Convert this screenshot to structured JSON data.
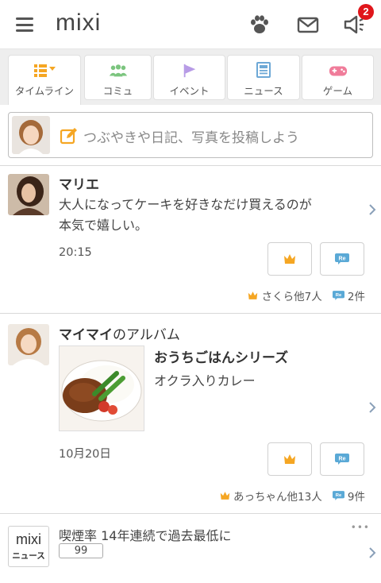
{
  "header": {
    "logo": "mixi",
    "notification_count": "2",
    "icons": [
      "menu-icon",
      "paw-icon",
      "mail-icon",
      "megaphone-icon"
    ]
  },
  "tabs": [
    {
      "label": "タイムライン",
      "icon": "timeline-icon",
      "color": "#f0a030",
      "active": true
    },
    {
      "label": "コミュ",
      "icon": "community-icon",
      "color": "#7cc57f",
      "active": false
    },
    {
      "label": "イベント",
      "icon": "flag-icon",
      "color": "#b79be6",
      "active": false
    },
    {
      "label": "ニュース",
      "icon": "news-icon",
      "color": "#6da8d6",
      "active": false
    },
    {
      "label": "ゲーム",
      "icon": "gamepad-icon",
      "color": "#f07c9a",
      "active": false
    }
  ],
  "compose": {
    "placeholder": "つぶやきや日記、写真を投稿しよう"
  },
  "posts": [
    {
      "name": "マリエ",
      "text_line1": "大人になってケーキを好きなだけ買えるのが",
      "text_line2": "本気で嬉しい。",
      "time": "20:15",
      "likes": "さくら他7人",
      "comments": "2件"
    },
    {
      "name": "マイマイ",
      "suffix": "のアルバム",
      "album_title": "おうちごはんシリーズ",
      "album_subtitle": "オクラ入りカレー",
      "time": "10月20日",
      "likes": "あっちゃん他13人",
      "comments": "9件"
    }
  ],
  "news": {
    "logo_top": "mixi",
    "logo_bottom": "ニュース",
    "title": "喫煙率 14年連続で過去最低に",
    "count": "99",
    "more": "•••"
  },
  "colors": {
    "accent_orange": "#f5a623",
    "re_blue": "#5aa9d6",
    "badge_red": "#e0161b"
  }
}
